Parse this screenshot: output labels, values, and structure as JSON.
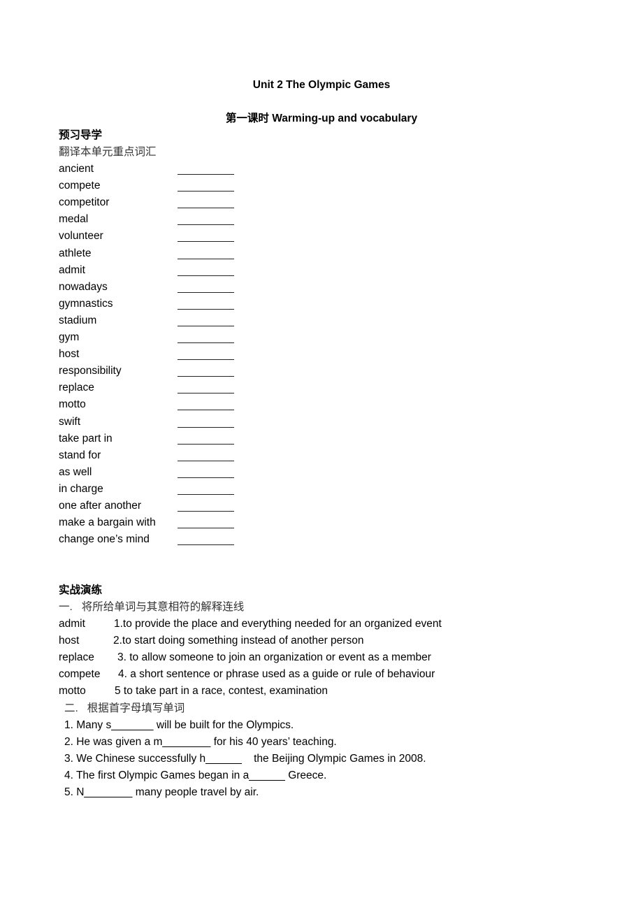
{
  "document": {
    "title": "Unit 2 The Olympic Games",
    "subtitle": "第一课时 Warming-up and vocabulary",
    "preview_section": {
      "heading": "预习导学",
      "instruction": "翻译本单元重点词汇",
      "vocabulary": [
        "ancient",
        "compete",
        "competitor",
        "medal",
        "volunteer",
        "athlete",
        "admit",
        "nowadays",
        "gymnastics",
        "stadium",
        "gym",
        "host",
        "responsibility",
        "replace",
        "motto",
        "swift",
        "take part in",
        "stand for",
        "as well",
        "in charge",
        "one after another",
        "make a bargain with",
        "change one’s mind"
      ],
      "blank": "__________"
    },
    "practice_section": {
      "heading": "实战演练",
      "exercise1": {
        "instruction": "一.   将所给单词与其意相符的解释连线",
        "rows": [
          {
            "word": "admit",
            "definition": "1.to provide the place and everything needed for an organized event"
          },
          {
            "word": "host",
            "definition": "2.to start doing something instead of another person"
          },
          {
            "word": "replace",
            "definition": "3. to allow someone to join an organization or event as a member"
          },
          {
            "word": "compete",
            "definition": "4. a short sentence or phrase used as a guide or rule of behaviour"
          },
          {
            "word": "motto",
            "definition": "5 to take part in a race, contest, examination"
          }
        ]
      },
      "exercise2": {
        "instruction": "二.   根据首字母填写单词",
        "sentences": [
          "1. Many s_______ will be built for the Olympics.",
          "2. He was given a m________ for his 40 years’ teaching.",
          "3. We Chinese successfully h______    the Beijing Olympic Games in 2008.",
          "4. The first Olympic Games began in a______ Greece.",
          "5. N________ many people travel by air."
        ]
      }
    }
  }
}
